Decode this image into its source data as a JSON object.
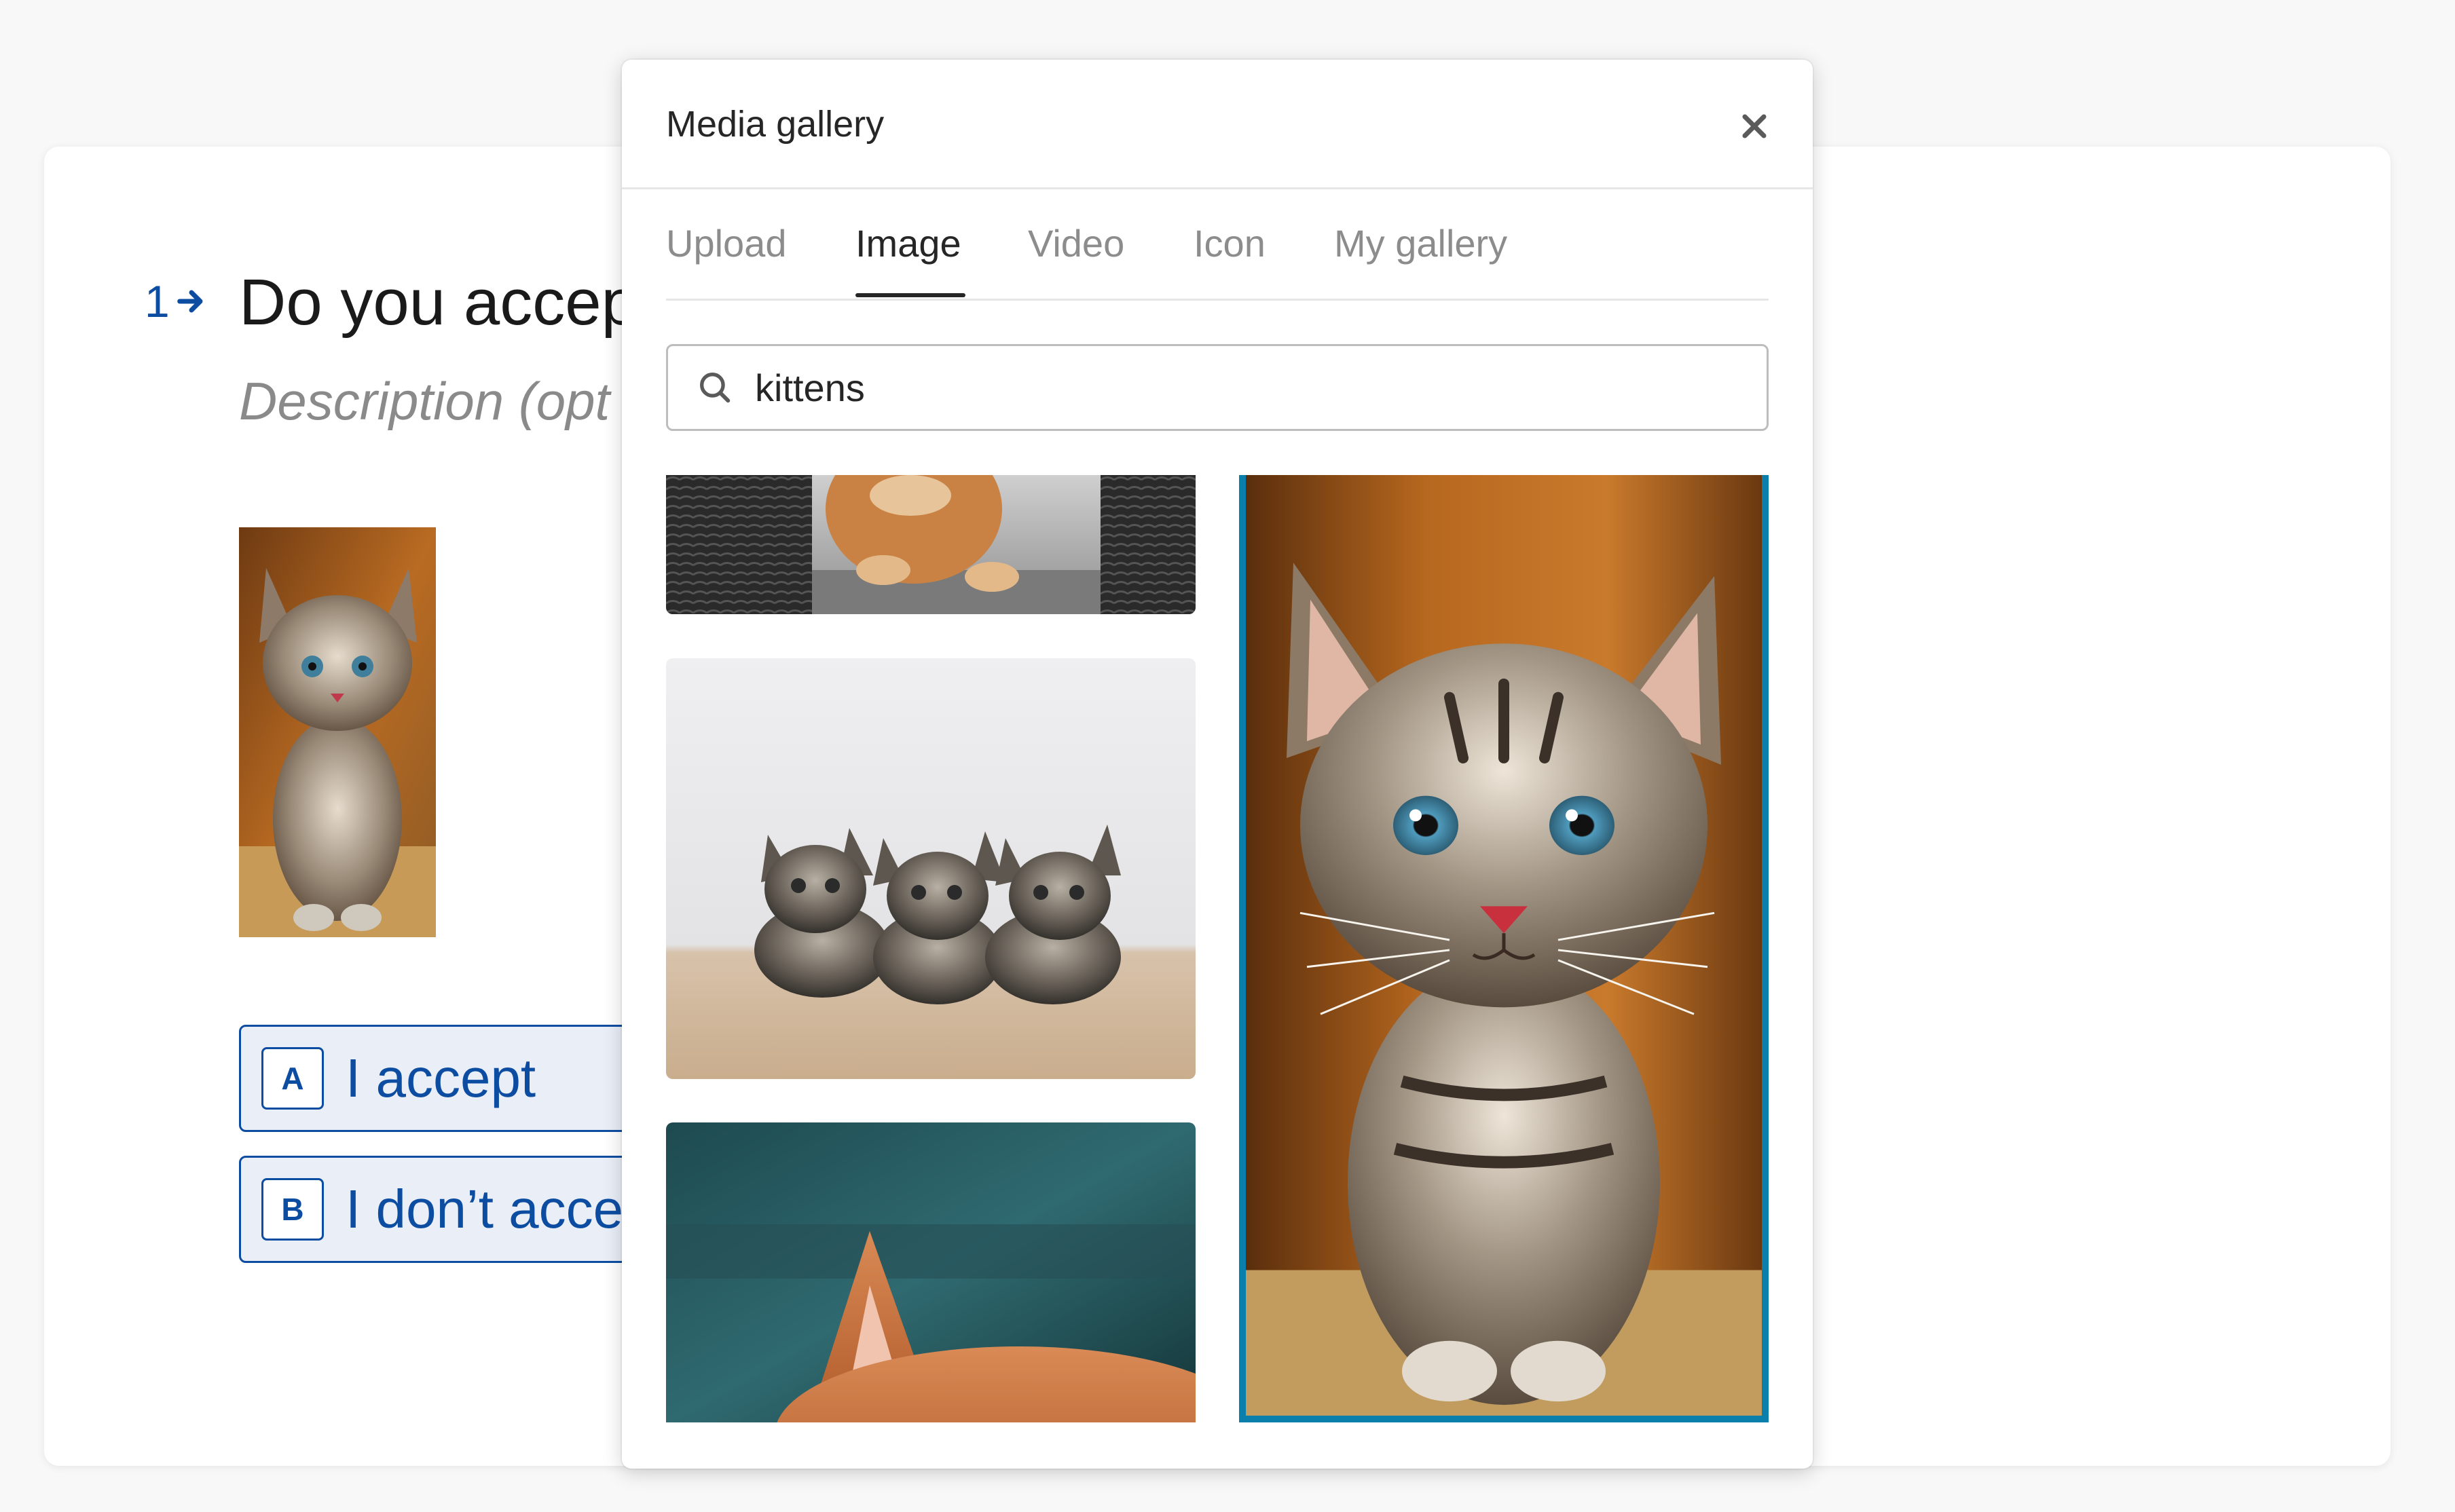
{
  "form": {
    "question_number": "1",
    "question_title": "Do you accept",
    "question_description": "Description (opt",
    "choices": [
      {
        "key": "A",
        "label": "I accept"
      },
      {
        "key": "B",
        "label": "I don’t acce"
      }
    ]
  },
  "modal": {
    "title": "Media gallery",
    "tabs": [
      {
        "label": "Upload",
        "active": false
      },
      {
        "label": "Image",
        "active": true
      },
      {
        "label": "Video",
        "active": false
      },
      {
        "label": "Icon",
        "active": false
      },
      {
        "label": "My gallery",
        "active": false
      }
    ],
    "search": {
      "value": "kittens"
    },
    "selected_image_index": 3
  },
  "colors": {
    "accent_blue": "#0d4da1",
    "choice_bg": "#e9eef7",
    "selected_border": "#0b7fab",
    "text_dark": "#262627",
    "text_muted": "#8c8c8c"
  },
  "icons": {
    "close": "close-icon",
    "search": "search-icon",
    "question_arrow": "arrow-right-icon"
  }
}
